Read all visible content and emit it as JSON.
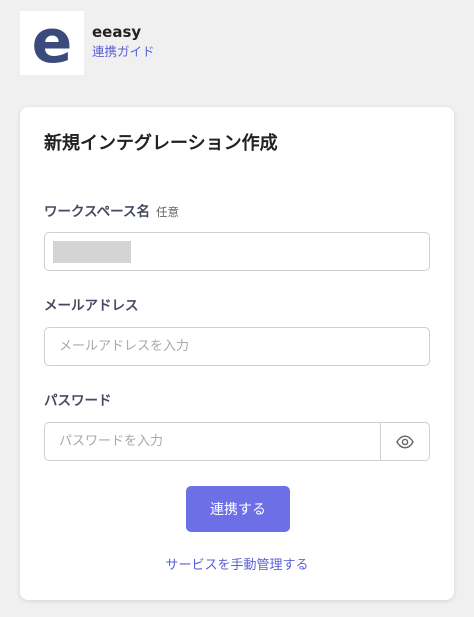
{
  "header": {
    "logo_letter": "e",
    "app_name": "eeasy",
    "guide_link": "連携ガイド"
  },
  "card": {
    "title": "新規インテグレーション作成",
    "workspace": {
      "label": "ワークスペース名",
      "optional": "任意"
    },
    "email": {
      "label": "メールアドレス",
      "placeholder": "メールアドレスを入力"
    },
    "password": {
      "label": "パスワード",
      "placeholder": "パスワードを入力"
    },
    "submit_label": "連携する",
    "manual_link": "サービスを手動管理する"
  },
  "colors": {
    "accent": "#6c6fe6",
    "link": "#5b5fd6",
    "logo": "#3a4a7c"
  }
}
